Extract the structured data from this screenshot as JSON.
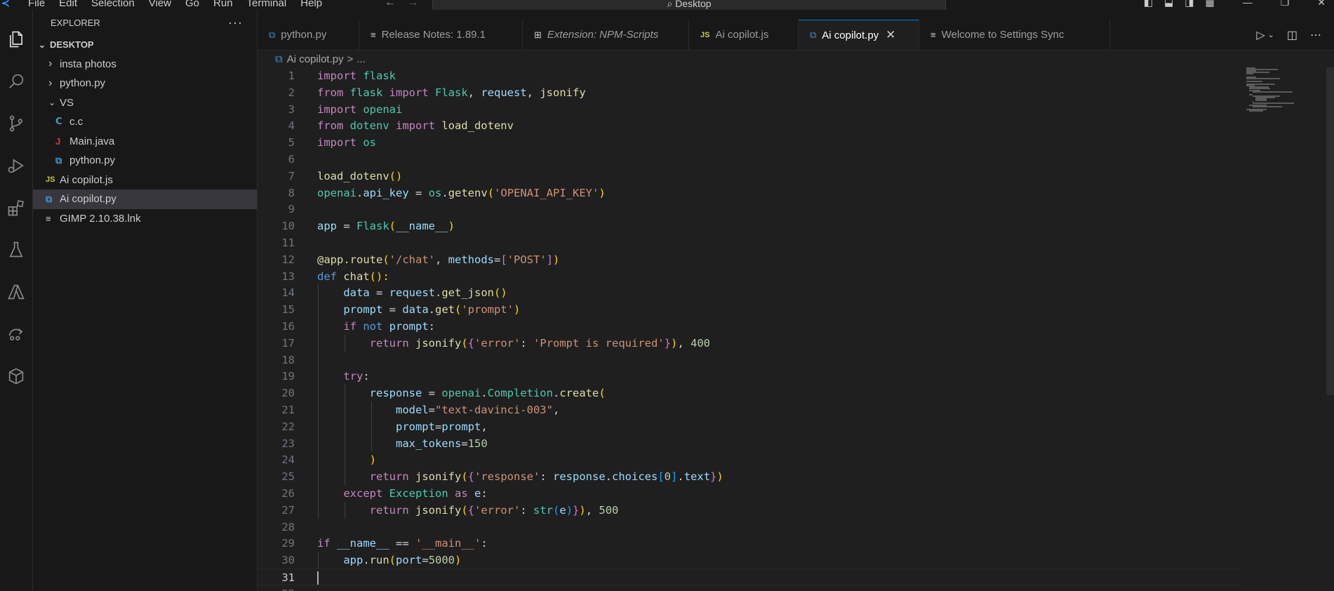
{
  "menu": [
    "File",
    "Edit",
    "Selection",
    "View",
    "Go",
    "Run",
    "Terminal",
    "Help"
  ],
  "search": {
    "label": "Desktop"
  },
  "explorer": {
    "title": "EXPLORER",
    "more": "···",
    "root": "DESKTOP",
    "items": [
      {
        "label": "insta photos",
        "type": "folder"
      },
      {
        "label": "python.py",
        "type": "folder"
      },
      {
        "label": "VS",
        "type": "folder-open"
      },
      {
        "label": "c.c",
        "type": "c"
      },
      {
        "label": "Main.java",
        "type": "java"
      },
      {
        "label": "python.py",
        "type": "py"
      },
      {
        "label": "Ai copilot.js",
        "type": "js"
      },
      {
        "label": "Ai copilot.py",
        "type": "py",
        "selected": true
      },
      {
        "label": "GIMP 2.10.38.lnk",
        "type": "lnk"
      }
    ]
  },
  "tabs": [
    {
      "label": "python.py",
      "icon": "python-icon"
    },
    {
      "label": "Release Notes: 1.89.1",
      "icon": "document-icon"
    },
    {
      "label": "Extension: NPM-Scripts",
      "icon": "extension-icon",
      "italic": true
    },
    {
      "label": "Ai copilot.js",
      "icon": "javascript-icon"
    },
    {
      "label": "Ai copilot.py",
      "icon": "python-icon",
      "active": true
    },
    {
      "label": "Welcome to Settings Sync",
      "icon": "document-icon"
    }
  ],
  "breadcrumb": {
    "file": "Ai copilot.py",
    "separator": ">",
    "rest": "..."
  },
  "editor": {
    "current_line": 31,
    "lines": [
      [
        [
          "import",
          "kw"
        ],
        [
          " flask",
          "mod"
        ]
      ],
      [
        [
          "from",
          "kw"
        ],
        [
          " flask ",
          "mod"
        ],
        [
          "import",
          "kw"
        ],
        [
          " Flask",
          "mod"
        ],
        [
          ", ",
          "op"
        ],
        [
          "request",
          "var"
        ],
        [
          ", ",
          "op"
        ],
        [
          "jsonify",
          "fn"
        ]
      ],
      [
        [
          "import",
          "kw"
        ],
        [
          " openai",
          "mod"
        ]
      ],
      [
        [
          "from",
          "kw"
        ],
        [
          " dotenv ",
          "mod"
        ],
        [
          "import",
          "kw"
        ],
        [
          " load_dotenv",
          "fn"
        ]
      ],
      [
        [
          "import",
          "kw"
        ],
        [
          " os",
          "mod"
        ]
      ],
      [],
      [
        [
          "load_dotenv",
          "fn"
        ],
        [
          "()",
          "b1"
        ]
      ],
      [
        [
          "openai",
          "mod"
        ],
        [
          ".",
          "op"
        ],
        [
          "api_key",
          "var"
        ],
        [
          " = ",
          "op"
        ],
        [
          "os",
          "mod"
        ],
        [
          ".",
          "op"
        ],
        [
          "getenv",
          "fn"
        ],
        [
          "(",
          "b1"
        ],
        [
          "'OPENAI_API_KEY'",
          "str"
        ],
        [
          ")",
          "b1"
        ]
      ],
      [],
      [
        [
          "app",
          "var"
        ],
        [
          " = ",
          "op"
        ],
        [
          "Flask",
          "mod"
        ],
        [
          "(",
          "b1"
        ],
        [
          "__name__",
          "var"
        ],
        [
          ")",
          "b1"
        ]
      ],
      [],
      [
        [
          "@app.route",
          "dec"
        ],
        [
          "(",
          "b1"
        ],
        [
          "'/chat'",
          "str"
        ],
        [
          ", ",
          "op"
        ],
        [
          "methods",
          "var"
        ],
        [
          "=",
          "op"
        ],
        [
          "[",
          "b2"
        ],
        [
          "'POST'",
          "str"
        ],
        [
          "]",
          "b2"
        ],
        [
          ")",
          "b1"
        ]
      ],
      [
        [
          "def",
          "kw2"
        ],
        [
          " chat",
          "fn"
        ],
        [
          "():",
          "b1"
        ]
      ],
      [
        [
          "    data",
          "var"
        ],
        [
          " = ",
          "op"
        ],
        [
          "request",
          "var"
        ],
        [
          ".",
          "op"
        ],
        [
          "get_json",
          "fn"
        ],
        [
          "()",
          "b1"
        ]
      ],
      [
        [
          "    prompt",
          "var"
        ],
        [
          " = ",
          "op"
        ],
        [
          "data",
          "var"
        ],
        [
          ".",
          "op"
        ],
        [
          "get",
          "fn"
        ],
        [
          "(",
          "b1"
        ],
        [
          "'prompt'",
          "str"
        ],
        [
          ")",
          "b1"
        ]
      ],
      [
        [
          "    if",
          "kw"
        ],
        [
          " not",
          "kw2"
        ],
        [
          " prompt",
          "var"
        ],
        [
          ":",
          "op"
        ]
      ],
      [
        [
          "        return",
          "kw"
        ],
        [
          " jsonify",
          "fn"
        ],
        [
          "(",
          "b1"
        ],
        [
          "{",
          "b2"
        ],
        [
          "'error'",
          "str"
        ],
        [
          ": ",
          "op"
        ],
        [
          "'Prompt is required'",
          "str"
        ],
        [
          "}",
          "b2"
        ],
        [
          ")",
          "b1"
        ],
        [
          ", ",
          "op"
        ],
        [
          "400",
          "num"
        ]
      ],
      [],
      [
        [
          "    try",
          "kw"
        ],
        [
          ":",
          "op"
        ]
      ],
      [
        [
          "        response",
          "var"
        ],
        [
          " = ",
          "op"
        ],
        [
          "openai",
          "mod"
        ],
        [
          ".",
          "op"
        ],
        [
          "Completion",
          "mod"
        ],
        [
          ".",
          "op"
        ],
        [
          "create",
          "fn"
        ],
        [
          "(",
          "b1"
        ]
      ],
      [
        [
          "            model",
          "var"
        ],
        [
          "=",
          "op"
        ],
        [
          "\"text-davinci-003\"",
          "str"
        ],
        [
          ",",
          "op"
        ]
      ],
      [
        [
          "            prompt",
          "var"
        ],
        [
          "=",
          "op"
        ],
        [
          "prompt",
          "var"
        ],
        [
          ",",
          "op"
        ]
      ],
      [
        [
          "            max_tokens",
          "var"
        ],
        [
          "=",
          "op"
        ],
        [
          "150",
          "num"
        ]
      ],
      [
        [
          "        )",
          "b1"
        ]
      ],
      [
        [
          "        return",
          "kw"
        ],
        [
          " jsonify",
          "fn"
        ],
        [
          "(",
          "b1"
        ],
        [
          "{",
          "b2"
        ],
        [
          "'response'",
          "str"
        ],
        [
          ": ",
          "op"
        ],
        [
          "response",
          "var"
        ],
        [
          ".",
          "op"
        ],
        [
          "choices",
          "var"
        ],
        [
          "[",
          "b3"
        ],
        [
          "0",
          "num"
        ],
        [
          "]",
          "b3"
        ],
        [
          ".",
          "op"
        ],
        [
          "text",
          "var"
        ],
        [
          "}",
          "b2"
        ],
        [
          ")",
          "b1"
        ]
      ],
      [
        [
          "    except",
          "kw"
        ],
        [
          " Exception",
          "mod"
        ],
        [
          " as",
          "kw"
        ],
        [
          " e",
          "var"
        ],
        [
          ":",
          "op"
        ]
      ],
      [
        [
          "        return",
          "kw"
        ],
        [
          " jsonify",
          "fn"
        ],
        [
          "(",
          "b1"
        ],
        [
          "{",
          "b2"
        ],
        [
          "'error'",
          "str"
        ],
        [
          ": ",
          "op"
        ],
        [
          "str",
          "mod"
        ],
        [
          "(",
          "b3"
        ],
        [
          "e",
          "var"
        ],
        [
          ")",
          "b3"
        ],
        [
          "}",
          "b2"
        ],
        [
          ")",
          "b1"
        ],
        [
          ", ",
          "op"
        ],
        [
          "500",
          "num"
        ]
      ],
      [],
      [
        [
          "if",
          "kw"
        ],
        [
          " __name__",
          "var"
        ],
        [
          " == ",
          "op"
        ],
        [
          "'__main__'",
          "str"
        ],
        [
          ":",
          "op"
        ]
      ],
      [
        [
          "    app",
          "var"
        ],
        [
          ".",
          "op"
        ],
        [
          "run",
          "fn"
        ],
        [
          "(",
          "b1"
        ],
        [
          "port",
          "var"
        ],
        [
          "=",
          "op"
        ],
        [
          "5000",
          "num"
        ],
        [
          ")",
          "b1"
        ]
      ],
      [],
      []
    ]
  }
}
